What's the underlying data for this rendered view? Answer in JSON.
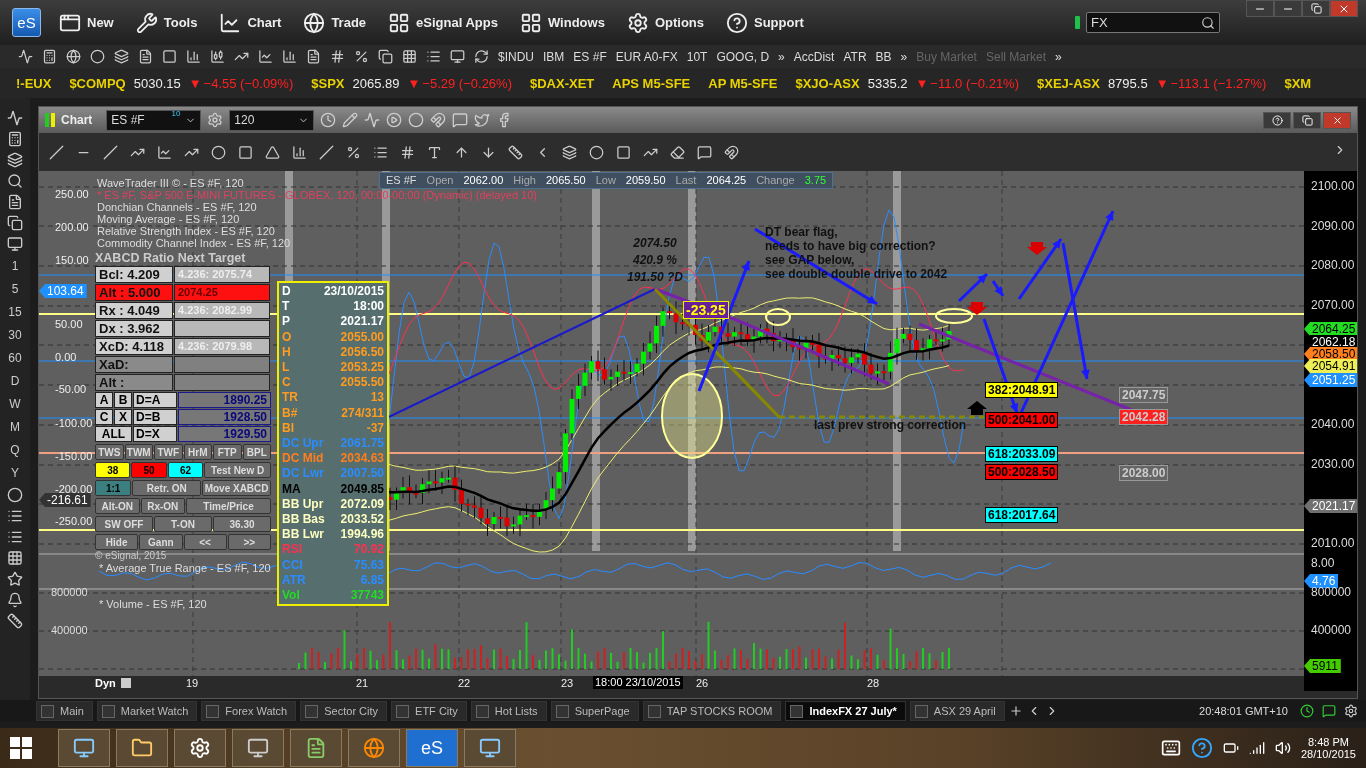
{
  "app_bar": {
    "logo": "eS",
    "menu": [
      {
        "label": "New"
      },
      {
        "label": "Tools"
      },
      {
        "label": "Chart"
      },
      {
        "label": "Trade"
      },
      {
        "label": "eSignal Apps"
      },
      {
        "label": "Windows"
      },
      {
        "label": "Options"
      },
      {
        "label": "Support"
      }
    ],
    "search": {
      "value": "FX"
    }
  },
  "toolbar": {
    "symbols": [
      {
        "label": "$INDU",
        "disabled": false
      },
      {
        "label": "IBM",
        "disabled": false
      },
      {
        "label": "ES #F",
        "disabled": false
      },
      {
        "label": "EUR A0-FX",
        "disabled": false
      },
      {
        "label": "10T",
        "disabled": false
      },
      {
        "label": "GOOG, D",
        "disabled": false
      },
      {
        "label": "»",
        "disabled": false
      },
      {
        "label": "AccDist",
        "disabled": false
      },
      {
        "label": "ATR",
        "disabled": false
      },
      {
        "label": "BB",
        "disabled": false
      },
      {
        "label": "»",
        "disabled": false
      },
      {
        "label": "Buy Market",
        "disabled": true
      },
      {
        "label": "Sell Market",
        "disabled": true
      },
      {
        "label": "»",
        "disabled": false
      }
    ]
  },
  "ticker": [
    {
      "symbol": "!-EUX"
    },
    {
      "symbol": "$COMPQ",
      "price": "5030.15",
      "arrow": "▼",
      "change": "−4.55 (−0.09%)"
    },
    {
      "symbol": "$SPX",
      "price": "2065.89",
      "arrow": "▼",
      "change": "−5.29 (−0.26%)"
    },
    {
      "symbol": "$DAX-XET"
    },
    {
      "symbol": "APS M5-SFE"
    },
    {
      "symbol": "AP M5-SFE"
    },
    {
      "symbol": "$XJO-ASX",
      "price": "5335.2",
      "arrow": "▼",
      "change": "−11.0 (−0.21%)"
    },
    {
      "symbol": "$XEJ-ASX",
      "price": "8795.5",
      "arrow": "▼",
      "change": "−113.1 (−1.27%)"
    },
    {
      "symbol": "$XM"
    }
  ],
  "intervals": [
    "1",
    "5",
    "15",
    "30",
    "60",
    "D",
    "W",
    "M",
    "Q",
    "Y"
  ],
  "chart_window": {
    "title": "Chart",
    "symbol": "ES #F",
    "symbol_badge": "10",
    "interval": "120"
  },
  "chart": {
    "legend": [
      "WaveTrader III © - ES #F, 120",
      "* ES #F, S&P 500 E-MINI FUTURES - GLOBEX, 120, 00:00-00:00 (Dynamic) (delayed 10)",
      "Donchian Channels - ES #F, 120",
      "Moving Average - ES #F, 120",
      "Relative Strength Index - ES #F, 120",
      "Commodity Channel Index - ES #F, 120"
    ],
    "quote": {
      "symbol": "ES #F",
      "fields": [
        {
          "label": "Open",
          "value": "2062.00"
        },
        {
          "label": "High",
          "value": "2065.50"
        },
        {
          "label": "Low",
          "value": "2059.50"
        },
        {
          "label": "Last",
          "value": "2064.25"
        },
        {
          "label": "Change",
          "value": "3.75"
        }
      ]
    },
    "price_ticks": [
      "2100.00",
      "2090.00",
      "2080.00",
      "2070.00",
      "2040.00",
      "2030.00",
      "2010.00"
    ],
    "osc_ticks": [
      "250.00",
      "200.00",
      "150.00",
      "50.00",
      "0.00",
      "-50.00",
      "-100.00",
      "-150.00",
      "-200.00",
      "-250.00"
    ],
    "osc_tags": [
      {
        "text": "103.64",
        "color": "#1e90ff"
      },
      {
        "text": "-216.61",
        "color": "#333333"
      }
    ],
    "price_tags": [
      {
        "text": "2064.25",
        "color": "#22dd22"
      },
      {
        "text": "2062.18",
        "color": "#000000"
      },
      {
        "text": "2058.50",
        "color": "#ff7f1e"
      },
      {
        "text": "2054.91",
        "color": "#eeee55"
      },
      {
        "text": "2051.25",
        "color": "#1e90ff"
      },
      {
        "text": "2021.17",
        "color": "#707070"
      }
    ],
    "atr": {
      "title": "* Average True Range - ES #F, 120",
      "tick": "8.00",
      "tag": {
        "text": "4.76",
        "color": "#1e90ff"
      }
    },
    "volume": {
      "title": "* Volume - ES #F, 120",
      "ticks": [
        "800000",
        "400000"
      ],
      "left_ticks": [
        "800000",
        "400000"
      ],
      "tag": {
        "text": "5911",
        "color": "#44cc00"
      }
    },
    "dates": [
      "19",
      "21",
      "22",
      "23",
      "26",
      "28"
    ],
    "cursor_date": "18:00 23/10/2015",
    "dyn": "Dyn",
    "xabcd": {
      "title": "XABCD Ratio Next Target",
      "ratios": [
        {
          "label": "Bcl:",
          "value": "4.209",
          "target": "4.236: 2075.74",
          "active": true,
          "alert": false
        },
        {
          "label": "Alt :",
          "value": "5.000",
          "target": "2074.25",
          "active": true,
          "alert": true
        },
        {
          "label": "Rx :",
          "value": "4.049",
          "target": "4.236: 2082.99",
          "active": true,
          "alert": false
        },
        {
          "label": "Dx :",
          "value": "3.962",
          "active": true,
          "alert": false
        },
        {
          "label": "XcD:",
          "value": "4.118",
          "target": "4.236: 2079.98",
          "active": true,
          "alert": false
        },
        {
          "label": "XaD:",
          "active": false,
          "alert": false
        },
        {
          "label": "Alt :",
          "active": false,
          "alert": false
        }
      ],
      "modes": [
        {
          "keys": [
            "A",
            "B"
          ],
          "rule": "D=A",
          "value": "1890.25"
        },
        {
          "keys": [
            "C",
            "X"
          ],
          "rule": "D=B",
          "value": "1928.50"
        },
        {
          "keys": [
            "ALL"
          ],
          "rule": "D=X",
          "value": "1929.50"
        }
      ],
      "button_rows": [
        [
          {
            "label": "TWS"
          },
          {
            "label": "TWM"
          },
          {
            "label": "TWF"
          },
          {
            "label": "HrM"
          },
          {
            "label": "FTP"
          },
          {
            "label": "BPL"
          }
        ],
        [
          {
            "label": "38",
            "color": "#ffff00"
          },
          {
            "label": "50",
            "color": "#ff0000"
          },
          {
            "label": "62",
            "color": "#00ffff"
          },
          {
            "label": "Test New D"
          }
        ],
        [
          {
            "label": "1:1",
            "color": "#3c7f80"
          },
          {
            "label": "Retr. ON"
          },
          {
            "label": "Move XABCD"
          }
        ],
        [
          {
            "label": "Alt-ON"
          },
          {
            "label": "Rx-ON"
          },
          {
            "label": "Time/Price"
          }
        ],
        [
          {
            "label": "SW OFF"
          },
          {
            "label": "T-ON"
          },
          {
            "label": "36.30"
          }
        ],
        [
          {
            "label": "Hide"
          },
          {
            "label": "Gann"
          },
          {
            "label": "<<"
          },
          {
            "label": ">>"
          }
        ]
      ],
      "copyright": "© eSignal, 2015"
    },
    "data_window": [
      {
        "label": "D",
        "value": "23/10/2015",
        "color": "#ffffff"
      },
      {
        "label": "T",
        "value": "18:00",
        "color": "#ffffff"
      },
      {
        "label": "P",
        "value": "2021.17",
        "color": "#ffffff"
      },
      {
        "label": "O",
        "value": "2055.00",
        "color": "#ff9c1e"
      },
      {
        "label": "H",
        "value": "2056.50",
        "color": "#ff9c1e"
      },
      {
        "label": "L",
        "value": "2053.25",
        "color": "#ff9c1e"
      },
      {
        "label": "C",
        "value": "2055.50",
        "color": "#ff9c1e"
      },
      {
        "label": "TR",
        "value": "13",
        "color": "#ff9c1e"
      },
      {
        "label": "B#",
        "value": "274/311",
        "color": "#ff9c1e"
      },
      {
        "label": "BI",
        "value": "-37",
        "color": "#ff9c1e"
      },
      {
        "label": "DC Upr",
        "value": "2061.75",
        "color": "#2a8cff"
      },
      {
        "label": "DC Mid",
        "value": "2034.63",
        "color": "#ff7f1e"
      },
      {
        "label": "DC Lwr",
        "value": "2007.50",
        "color": "#2a8cff"
      },
      {
        "label": "MA",
        "value": "2049.85",
        "color": "#000000"
      },
      {
        "label": "BB Upr",
        "value": "2072.09",
        "color": "#ffffc0"
      },
      {
        "label": "BB Bas",
        "value": "2033.52",
        "color": "#ffffc0"
      },
      {
        "label": "BB Lwr",
        "value": "1994.96",
        "color": "#ffffc0"
      },
      {
        "label": "RSI",
        "value": "70.92",
        "color": "#ff3050"
      },
      {
        "label": "CCI",
        "value": "75.63",
        "color": "#2a8cff"
      },
      {
        "label": "ATR",
        "value": "6.85",
        "color": "#2a8cff"
      },
      {
        "label": "Vol",
        "value": "37743",
        "color": "#22dd22"
      }
    ],
    "annotations": {
      "peak": [
        "2074.50",
        "420.9 %",
        "191.50 ?D"
      ],
      "move": "-23.25",
      "note": [
        "DT bear flag,",
        "needs to have big correction?",
        "see GAP below,",
        "see double double drive to 2042"
      ],
      "correction": "last prev strong correction"
    },
    "fib_labels": [
      {
        "text": "382:2048.91",
        "color": "#ffff00"
      },
      {
        "text": "500:2041.00",
        "color": "#ff0000"
      },
      {
        "text": "618:2033.09",
        "color": "#00ffff"
      },
      {
        "text": "500:2028.50",
        "color": "#ff0000"
      },
      {
        "text": "618:2017.64",
        "color": "#00ffff"
      }
    ],
    "level_boxes": [
      {
        "text": "2047.75",
        "color": "#666666"
      },
      {
        "text": "2042.28",
        "color": "#ff2020"
      },
      {
        "text": "2028.00",
        "color": "#666666"
      }
    ]
  },
  "tabs": [
    {
      "label": "Main",
      "selected": false
    },
    {
      "label": "Market Watch",
      "selected": false
    },
    {
      "label": "Forex Watch",
      "selected": false
    },
    {
      "label": "Sector City",
      "selected": false
    },
    {
      "label": "ETF City",
      "selected": false
    },
    {
      "label": "Hot Lists",
      "selected": false
    },
    {
      "label": "SuperPage",
      "selected": false
    },
    {
      "label": "TAP STOCKS ROOM",
      "selected": false
    },
    {
      "label": "IndexFX 27 July*",
      "selected": true
    },
    {
      "label": "ASX 29 April",
      "selected": false
    }
  ],
  "status_clock": "20:48:01 GMT+10",
  "taskbar": {
    "es_label": "eS",
    "time": "8:48 PM",
    "date": "28/10/2015"
  }
}
